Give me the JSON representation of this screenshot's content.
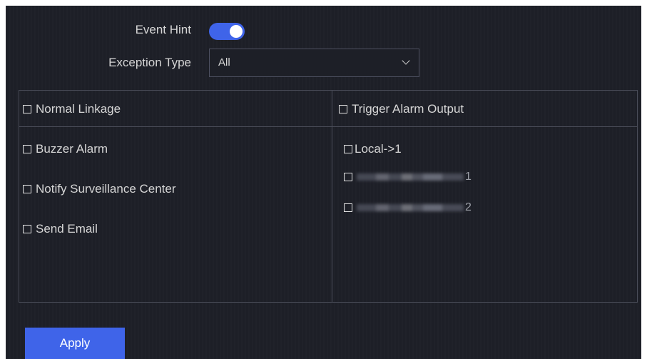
{
  "event_hint": {
    "label": "Event Hint",
    "enabled": true
  },
  "exception_type": {
    "label": "Exception Type",
    "selected": "All"
  },
  "linkage": {
    "normal_header": "Normal Linkage",
    "trigger_header": "Trigger Alarm Output",
    "normal_items": [
      {
        "label": "Buzzer Alarm",
        "checked": false
      },
      {
        "label": "Notify Surveillance Center",
        "checked": false
      },
      {
        "label": "Send Email",
        "checked": false
      }
    ],
    "trigger_items": [
      {
        "label": "Local->1",
        "checked": false
      },
      {
        "label": "1",
        "checked": false,
        "name_obscured": true
      },
      {
        "label": "2",
        "checked": false,
        "name_obscured": true
      }
    ]
  },
  "apply_label": "Apply",
  "colors": {
    "accent": "#3f64e9",
    "panel_bg": "#1d1f27",
    "border": "#4a4d59",
    "text": "#d6d6d6"
  }
}
